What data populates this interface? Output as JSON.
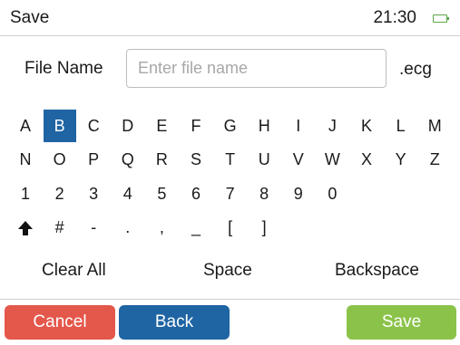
{
  "header": {
    "title": "Save",
    "time": "21:30",
    "battery_icon": "battery-full-icon",
    "battery_level": 1.0
  },
  "file_name": {
    "label": "File Name",
    "placeholder": "Enter file name",
    "value": "",
    "extension": ".ecg"
  },
  "keyboard": {
    "selected_key": "B",
    "rows": [
      [
        "A",
        "B",
        "C",
        "D",
        "E",
        "F",
        "G",
        "H",
        "I",
        "J",
        "K",
        "L",
        "M"
      ],
      [
        "N",
        "O",
        "P",
        "Q",
        "R",
        "S",
        "T",
        "U",
        "V",
        "W",
        "X",
        "Y",
        "Z"
      ],
      [
        "1",
        "2",
        "3",
        "4",
        "5",
        "6",
        "7",
        "8",
        "9",
        "0"
      ],
      [
        "shift-arrow-icon",
        "#",
        "-",
        ".",
        ",",
        "_",
        "[",
        "]"
      ]
    ]
  },
  "actions": {
    "clear_all": "Clear All",
    "space": "Space",
    "backspace": "Backspace"
  },
  "buttons": {
    "cancel": "Cancel",
    "back": "Back",
    "save": "Save"
  },
  "colors": {
    "selected_key": "#1f64a3",
    "cancel": "#e4574b",
    "back": "#1f64a3",
    "save": "#8bc34a",
    "battery": "#5aa84a"
  }
}
